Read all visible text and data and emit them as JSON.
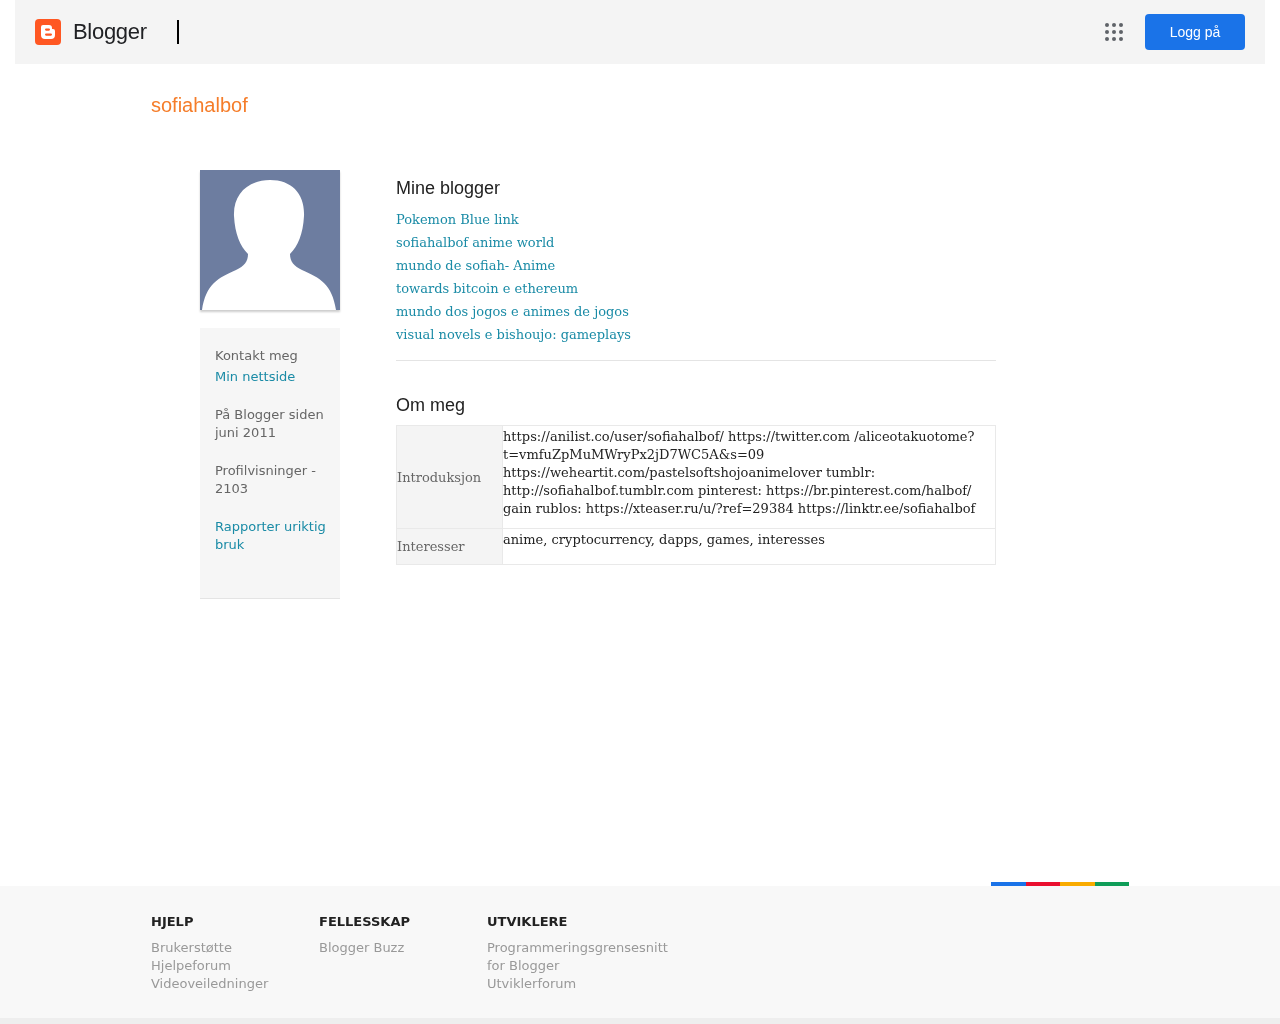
{
  "header": {
    "brand": "Blogger",
    "login_button": "Logg på"
  },
  "profile": {
    "username": "sofiahalbof",
    "sidebar": [
      {
        "kind": "plain",
        "text": "Kontakt meg"
      },
      {
        "kind": "link",
        "text": "Min nettside"
      },
      {
        "kind": "gap"
      },
      {
        "kind": "plain",
        "text": "På Blogger siden juni 2011"
      },
      {
        "kind": "gap"
      },
      {
        "kind": "plain",
        "text": "Profilvisninger - 2103"
      },
      {
        "kind": "gap"
      },
      {
        "kind": "link",
        "text": "Rapporter uriktig bruk"
      }
    ]
  },
  "blogs": {
    "title": "Mine blogger",
    "items": [
      "Pokemon Blue link",
      "sofiahalbof anime world",
      "mundo de sofiah- Anime",
      "towards bitcoin e ethereum",
      "mundo dos jogos e animes de jogos",
      "visual novels e bishoujo: gameplays"
    ]
  },
  "about": {
    "title": "Om meg",
    "rows": [
      {
        "label": "Introduksjon",
        "value": "https://anilist.co/user/sofiahalbof/ https://twitter.com /aliceotakuotome?t=vmfuZpMuMWryPx2jD7WC5A&s=09 https://weheartit.com/pastelsoftshojoanimelover tumblr: http://sofiahalbof.tumblr.com pinterest: https://br.pinterest.com/halbof/ gain rublos: https://xteaser.ru/u/?ref=29384 https://linktr.ee/sofiahalbof"
      },
      {
        "label": "Interesser",
        "value": "anime, cryptocurrency, dapps, games, interesses"
      }
    ]
  },
  "footer": {
    "columns": [
      {
        "title": "HJELP",
        "links": [
          "Brukerstøtte",
          "Hjelpeforum",
          "Videoveiledninger"
        ]
      },
      {
        "title": "FELLESSKAP",
        "links": [
          "Blogger Buzz"
        ]
      },
      {
        "title": "UTVIKLERE",
        "links": [
          "Programmeringsgrensesnitt for Blogger",
          "Utviklerforum"
        ]
      }
    ]
  }
}
